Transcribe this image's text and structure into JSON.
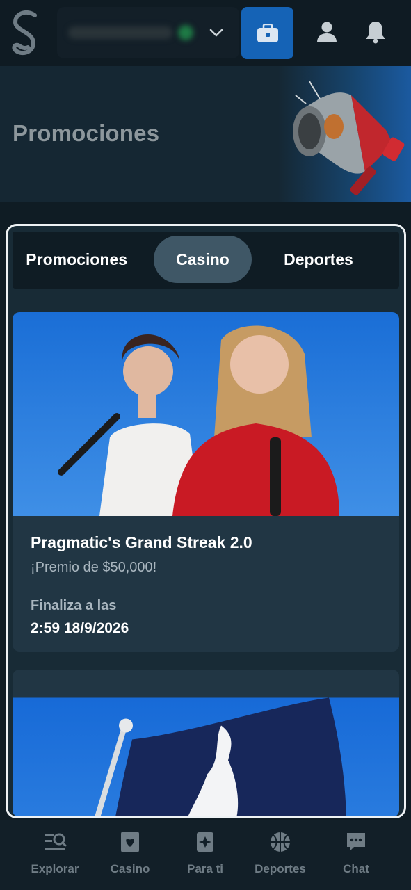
{
  "header": {
    "logo_icon": "s-logo-icon",
    "account_value": "",
    "wallet_icon": "wallet-icon",
    "user_icon": "user-icon",
    "bell_icon": "bell-icon",
    "accent_color": "#1563b6"
  },
  "hero": {
    "title": "Promociones",
    "image_icon": "megaphone-icon"
  },
  "tabs": [
    {
      "label": "Promociones",
      "selected": false
    },
    {
      "label": "Casino",
      "selected": true
    },
    {
      "label": "Deportes",
      "selected": false
    }
  ],
  "promotions": [
    {
      "title": "Pragmatic's Grand Streak 2.0",
      "subtitle": "¡Premio de $50,000!",
      "ends_label": "Finaliza a las",
      "ends_date": "2:59 18/9/2026"
    },
    {
      "title": "",
      "subtitle": "",
      "ends_label": "",
      "ends_date": ""
    }
  ],
  "bottom_nav": [
    {
      "label": "Explorar",
      "icon": "explore-icon"
    },
    {
      "label": "Casino",
      "icon": "casino-card-icon"
    },
    {
      "label": "Para ti",
      "icon": "for-you-icon"
    },
    {
      "label": "Deportes",
      "icon": "basketball-icon"
    },
    {
      "label": "Chat",
      "icon": "chat-icon"
    }
  ]
}
